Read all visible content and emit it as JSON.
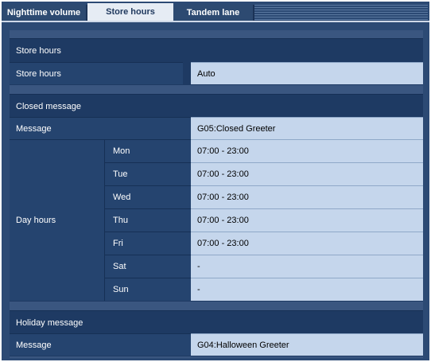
{
  "tabs": [
    {
      "label": "Nighttime volume",
      "active": false
    },
    {
      "label": "Store hours",
      "active": true
    },
    {
      "label": "Tandem lane",
      "active": false
    }
  ],
  "store_hours_section": {
    "title": "Store hours",
    "row_label": "Store hours",
    "row_value": "Auto"
  },
  "closed_message_section": {
    "title": "Closed message",
    "message_label": "Message",
    "message_value": "G05:Closed Greeter",
    "day_hours_label": "Day hours",
    "days": [
      {
        "day": "Mon",
        "hours": "07:00 - 23:00"
      },
      {
        "day": "Tue",
        "hours": "07:00 - 23:00"
      },
      {
        "day": "Wed",
        "hours": "07:00 - 23:00"
      },
      {
        "day": "Thu",
        "hours": "07:00 - 23:00"
      },
      {
        "day": "Fri",
        "hours": "07:00 - 23:00"
      },
      {
        "day": "Sat",
        "hours": "-"
      },
      {
        "day": "Sun",
        "hours": "-"
      }
    ]
  },
  "holiday_message_section": {
    "title": "Holiday message",
    "message_label": "Message",
    "message_value": "G04:Halloween Greeter"
  },
  "colors": {
    "frame": "#2c4a74",
    "section_header": "#1e3a63",
    "label_cell": "#25446f",
    "value_cell": "#c5d6ec",
    "active_tab": "#e6ecf4"
  }
}
